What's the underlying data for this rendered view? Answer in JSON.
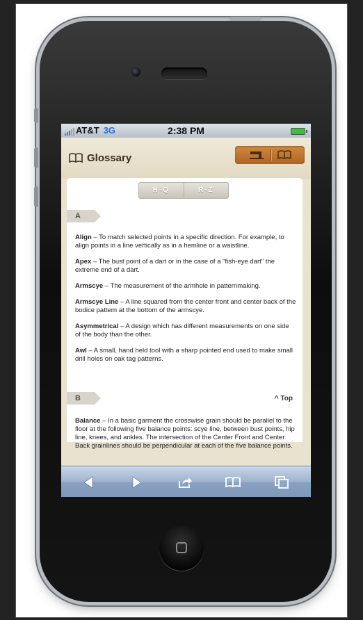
{
  "status_bar": {
    "carrier": "AT&T",
    "network": "3G",
    "time": "2:38 PM"
  },
  "header": {
    "title": "Glossary"
  },
  "index_tabs": [
    "H-Q",
    "R-Z"
  ],
  "sections": [
    {
      "letter": "A",
      "entries": [
        {
          "term": "Align",
          "definition": " – To match selected points in a specific direction. For example, to align points in a line vertically as in a hemline or a waistline."
        },
        {
          "term": "Apex",
          "definition": " – The bust point of a dart or in the case of a \"fish-eye dart\" the extreme end of a dart."
        },
        {
          "term": "Armscye",
          "definition": " – The measurement of the armhole in patternmaking."
        },
        {
          "term": "Armscye Line",
          "definition": " – A line squared from the center front and center back of the bodice pattern at the bottom of the armscye."
        },
        {
          "term": "Asymmetrical",
          "definition": " – A design which has different measurements on one side of the body than the other."
        },
        {
          "term": "Awl",
          "definition": " – A small, hand held tool with a sharp pointed end used to make small drill holes on oak tag patterns."
        }
      ]
    },
    {
      "letter": "B",
      "top_label": "^ Top",
      "entries": [
        {
          "term": "Balance",
          "definition": " – In a basic garment the crosswise grain should be parallel to the floor at the following five balance points: scye line, between bust points, hip line, knees, and ankles. The intersection of the Center Front and Center Back grainlines should be perpendicular at each of the five balance points."
        }
      ]
    }
  ],
  "toolbar_icons": [
    "back-icon",
    "forward-icon",
    "share-icon",
    "bookmarks-icon",
    "pages-icon"
  ],
  "colors": {
    "accent": "#c07a33",
    "toolbar": "#8fa6c4",
    "network": "#2f6fd0"
  }
}
